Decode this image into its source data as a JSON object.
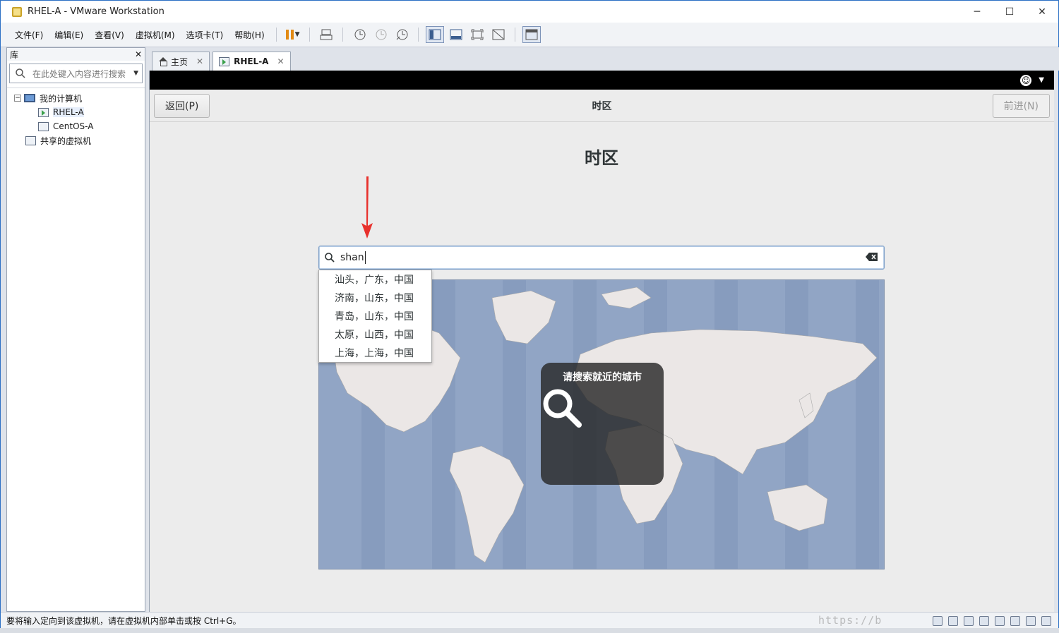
{
  "window": {
    "title": "RHEL-A - VMware Workstation",
    "controls": {
      "minimize": "─",
      "maximize": "☐",
      "close": "✕"
    }
  },
  "menubar": {
    "items": [
      "文件(F)",
      "编辑(E)",
      "查看(V)",
      "虚拟机(M)",
      "选项卡(T)",
      "帮助(H)"
    ],
    "toolbar_icons": [
      "pause-icon",
      "send-ctrl-alt-del-icon",
      "snapshot-icon",
      "revert-snapshot-icon",
      "snapshot-manager-icon",
      "show-library-icon",
      "thumbnail-bar-icon",
      "full-screen-icon",
      "unity-icon",
      "console-view-icon"
    ]
  },
  "library": {
    "title": "库",
    "close": "✕",
    "search_placeholder": "在此处键入内容进行搜索",
    "tree": {
      "root": "我的计算机",
      "children": [
        "RHEL-A",
        "CentOS-A"
      ],
      "shared": "共享的虚拟机",
      "expander": "−"
    }
  },
  "tabs": [
    {
      "label": "主页",
      "close": "✕",
      "icon": "home-icon"
    },
    {
      "label": "RHEL-A",
      "close": "✕",
      "icon": "vm-icon",
      "active": true
    }
  ],
  "installer": {
    "back": "返回(P)",
    "header_title": "时区",
    "next": "前进(N)",
    "page_title": "时区",
    "search_value": "shan",
    "suggestions": [
      "汕头，广东，中国",
      "济南，山东，中国",
      "青岛，山东，中国",
      "太原，山西，中国",
      "上海，上海，中国"
    ],
    "map_hint": "请搜索就近的城市"
  },
  "statusbar": {
    "text": "要将输入定向到该虚拟机，请在虚拟机内部单击或按 Ctrl+G。",
    "watermark": "https://b"
  },
  "colors": {
    "titlebar_border": "#2b6fc4",
    "map_ocean": "#91a5c5",
    "map_land": "#ebe7e6",
    "arrow": "#e8312c",
    "pause": "#e28a14"
  }
}
